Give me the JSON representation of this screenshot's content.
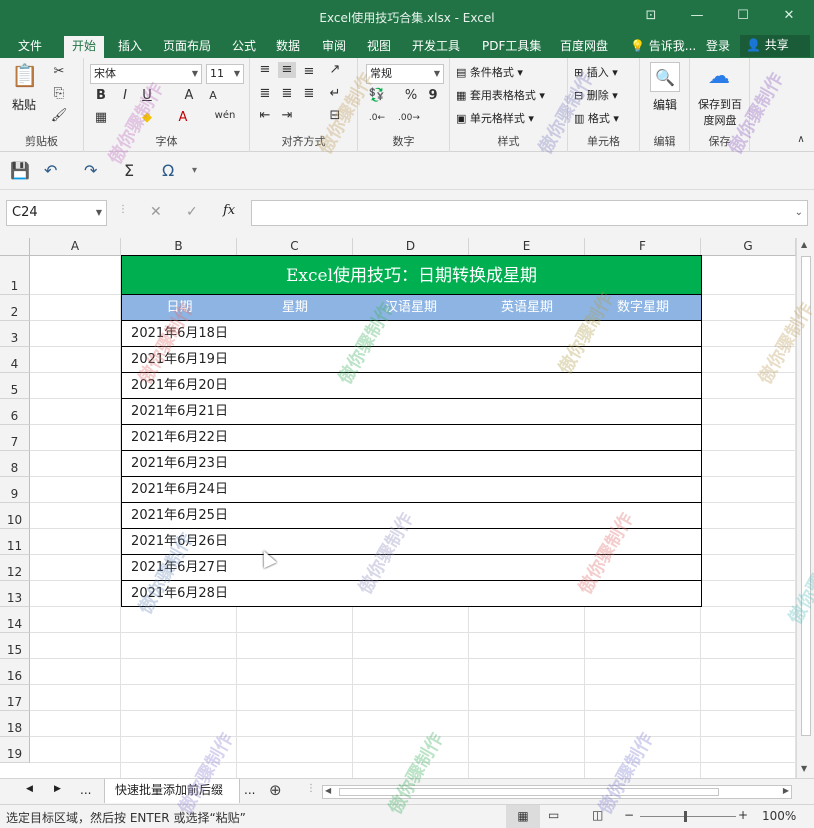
{
  "window": {
    "title": "Excel使用技巧合集.xlsx - Excel",
    "btn_restore_icon": "ribbon-display-icon",
    "btn_min": "—",
    "btn_max": "☐",
    "btn_close": "✕"
  },
  "tabs": [
    "文件",
    "开始",
    "插入",
    "页面布局",
    "公式",
    "数据",
    "审阅",
    "视图",
    "开发工具",
    "PDF工具集",
    "百度网盘"
  ],
  "active_tab": "开始",
  "tell_me": "告诉我...",
  "login": "登录",
  "share": "共享",
  "ribbon": {
    "clipboard": {
      "label": "剪贴板",
      "paste": "粘贴"
    },
    "font": {
      "label": "字体",
      "font_name": "宋体",
      "font_size": "11",
      "bold": "B",
      "italic": "I",
      "underline": "U",
      "grow": "A",
      "shrink": "A",
      "phonetic": "wén"
    },
    "alignment": {
      "label": "对齐方式"
    },
    "number": {
      "label": "数字",
      "format": "常规",
      "percent": "%",
      "comma": "9"
    },
    "styles": {
      "label": "样式",
      "conditional": "条件格式",
      "table": "套用表格格式",
      "cell": "单元格样式"
    },
    "cells": {
      "label": "单元格",
      "insert": "插入",
      "delete": "删除",
      "format": "格式"
    },
    "editing": {
      "label": "编辑",
      "button": "编辑"
    },
    "save": {
      "label": "保存",
      "button": "保存到百度网盘"
    }
  },
  "formula_bar": {
    "name_box": "C24",
    "fx": "fx",
    "cancel": "✕",
    "enter": "✓",
    "value": ""
  },
  "columns": [
    "A",
    "B",
    "C",
    "D",
    "E",
    "F",
    "G"
  ],
  "rows": [
    "1",
    "2",
    "3",
    "4",
    "5",
    "6",
    "7",
    "8",
    "9",
    "10",
    "11",
    "12",
    "13",
    "14",
    "15",
    "16",
    "17",
    "18",
    "19"
  ],
  "sheet": {
    "title": "Excel使用技巧：日期转换成星期",
    "headers": [
      "日期",
      "星期",
      "汉语星期",
      "英语星期",
      "数字星期"
    ],
    "dates": [
      "2021年6月18日",
      "2021年6月19日",
      "2021年6月20日",
      "2021年6月21日",
      "2021年6月22日",
      "2021年6月23日",
      "2021年6月24日",
      "2021年6月25日",
      "2021年6月26日",
      "2021年6月27日",
      "2021年6月28日"
    ]
  },
  "sheet_tabs": {
    "ellipsis": "...",
    "active": "快速批量添加前后缀",
    "ellipsis2": "..."
  },
  "status": {
    "message": "选定目标区域，然后按 ENTER 或选择“粘贴”",
    "zoom": "100%"
  },
  "watermark": "傲你骤制作"
}
